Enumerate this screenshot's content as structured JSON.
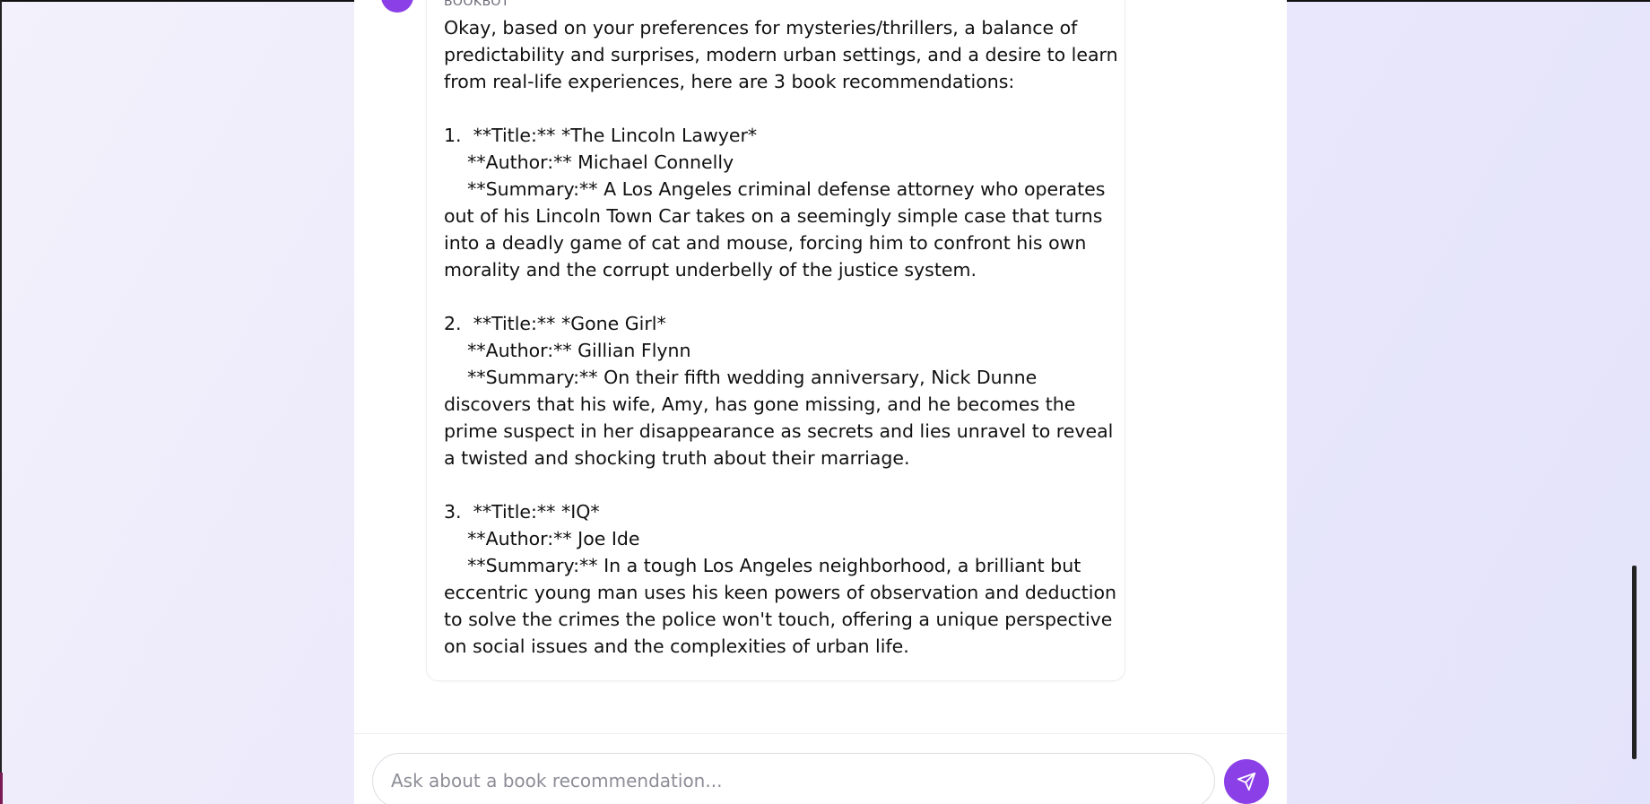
{
  "chat": {
    "sender_label": "BOOKBOT",
    "bot_message": "Okay, based on your preferences for mysteries/thrillers, a balance of predictability and surprises, modern urban settings, and a desire to learn from real-life experiences, here are 3 book recommendations:\n\n1.  **Title:** *The Lincoln Lawyer*\n    **Author:** Michael Connelly\n    **Summary:** A Los Angeles criminal defense attorney who operates out of his Lincoln Town Car takes on a seemingly simple case that turns into a deadly game of cat and mouse, forcing him to confront his own morality and the corrupt underbelly of the justice system.\n\n2.  **Title:** *Gone Girl*\n    **Author:** Gillian Flynn\n    **Summary:** On their fifth wedding anniversary, Nick Dunne discovers that his wife, Amy, has gone missing, and he becomes the prime suspect in her disappearance as secrets and lies unravel to reveal a twisted and shocking truth about their marriage.\n\n3.  **Title:** *IQ*\n    **Author:** Joe Ide\n    **Summary:** In a tough Los Angeles neighborhood, a brilliant but eccentric young man uses his keen powers of observation and deduction to solve the crimes the police won't touch, offering a unique perspective on social issues and the complexities of urban life."
  },
  "input": {
    "placeholder": "Ask about a book recommendation...",
    "value": ""
  },
  "icons": {
    "send": "send-icon",
    "avatar": "bot-avatar"
  },
  "colors": {
    "accent": "#8b3fe6",
    "background_start": "#f3f1fb",
    "background_end": "#e3e3fb",
    "panel": "#ffffff",
    "text": "#111111",
    "muted": "#6b6b78"
  }
}
